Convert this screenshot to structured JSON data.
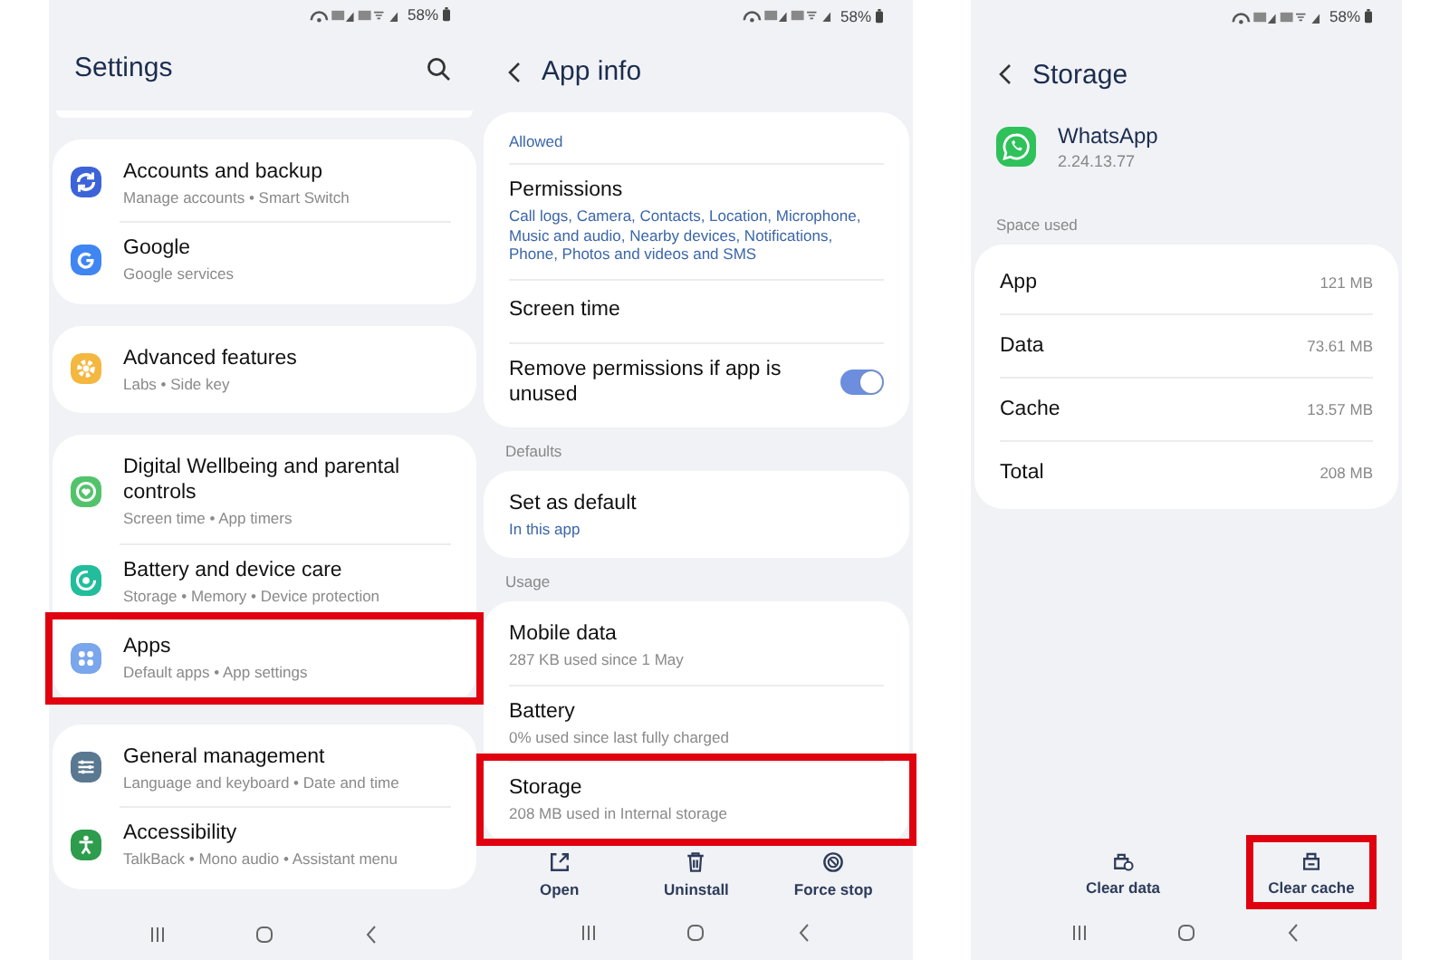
{
  "screens": [
    {
      "status_bar": {
        "battery": "58%"
      },
      "header": {
        "title": "Settings",
        "search": true
      },
      "sections": [
        {
          "clipped": true
        },
        {
          "items": [
            {
              "kind": "sync",
              "color": "#3d63d8",
              "title": "Accounts and backup",
              "subtitle": "Manage accounts  •  Smart Switch"
            },
            {
              "kind": "google",
              "color": "#3f86f2",
              "title": "Google",
              "subtitle": "Google services"
            }
          ]
        },
        {
          "items": [
            {
              "kind": "gear",
              "color": "#f4b73f",
              "title": "Advanced features",
              "subtitle": "Labs  •  Side key"
            }
          ]
        },
        {
          "items": [
            {
              "kind": "wellbeing",
              "color": "#53c36b",
              "title": "Digital Wellbeing and parental controls",
              "subtitle": "Screen time  •  App timers"
            },
            {
              "kind": "care",
              "color": "#22bd9c",
              "title": "Battery and device care",
              "subtitle": "Storage  •  Memory  •  Device protection"
            },
            {
              "kind": "apps",
              "color": "#7aa6ec",
              "title": "Apps",
              "subtitle": "Default apps  •  App settings",
              "highlighted": true
            }
          ]
        },
        {
          "items": [
            {
              "kind": "sliders",
              "color": "#5b7891",
              "title": "General management",
              "subtitle": "Language and keyboard  •  Date and time"
            },
            {
              "kind": "person",
              "color": "#2e9c4d",
              "title": "Accessibility",
              "subtitle": "TalkBack  •  Mono audio  •  Assistant menu"
            }
          ]
        }
      ]
    },
    {
      "status_bar": {
        "battery": "58%"
      },
      "header": {
        "title": "App info",
        "back": true
      },
      "sections": [
        {
          "items": [
            {
              "subtitle": "Allowed",
              "accent": true
            },
            {
              "title": "Permissions",
              "subtitle": "Call logs, Camera, Contacts, Location, Microphone, Music and audio, Nearby devices, Notifications, Phone, Photos and videos and SMS",
              "accent": true
            },
            {
              "title": "Screen time"
            },
            {
              "title": "Remove permissions if app is unused",
              "toggle": {
                "on": true
              }
            }
          ]
        },
        {
          "label": "Defaults",
          "items": [
            {
              "title": "Set as default",
              "subtitle": "In this app",
              "accent": true
            }
          ]
        },
        {
          "label": "Usage",
          "items": [
            {
              "title": "Mobile data",
              "subtitle": "287 KB used since 1 May",
              "accent": false
            },
            {
              "title": "Battery",
              "subtitle": "0% used since last fully charged",
              "accent": false
            },
            {
              "title": "Storage",
              "subtitle": "208 MB used in Internal storage",
              "accent": false,
              "highlighted": true
            }
          ]
        }
      ],
      "actions": [
        {
          "kind": "open",
          "label": "Open"
        },
        {
          "kind": "trash",
          "label": "Uninstall"
        },
        {
          "kind": "stop",
          "label": "Force stop"
        }
      ]
    },
    {
      "status_bar": {
        "battery": "58%"
      },
      "header": {
        "title": "Storage",
        "back": true
      },
      "app": {
        "name": "WhatsApp",
        "version": "2.24.13.77"
      },
      "sections": [
        {
          "label": "Space used",
          "items": [
            {
              "title": "App",
              "value": "121 MB"
            },
            {
              "title": "Data",
              "value": "73.61 MB"
            },
            {
              "title": "Cache",
              "value": "13.57 MB"
            },
            {
              "title": "Total",
              "value": "208 MB"
            }
          ]
        }
      ],
      "actions": [
        {
          "kind": "clear-data",
          "label": "Clear data"
        },
        {
          "kind": "clear-cache",
          "label": "Clear cache",
          "highlighted": true
        }
      ]
    }
  ]
}
